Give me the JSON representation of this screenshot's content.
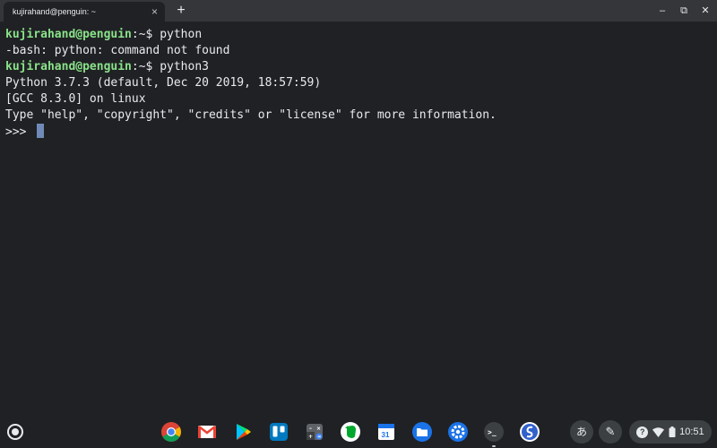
{
  "window": {
    "tab_title": "kujirahand@penguin: ~",
    "tab_close": "×",
    "new_tab": "+",
    "minimize": "–",
    "restore": "⧉",
    "close": "✕"
  },
  "terminal": {
    "lines": [
      {
        "user_host": "kujirahand@penguin",
        "path": ":~",
        "cmd": "$ python"
      },
      {
        "text": "-bash: python: command not found"
      },
      {
        "user_host": "kujirahand@penguin",
        "path": ":~",
        "cmd": "$ python3"
      },
      {
        "text": "Python 3.7.3 (default, Dec 20 2019, 18:57:59)"
      },
      {
        "text": "[GCC 8.3.0] on linux"
      },
      {
        "text": "Type \"help\", \"copyright\", \"credits\" or \"license\" for more information."
      },
      {
        "text": ">>> "
      }
    ]
  },
  "shelf": {
    "apps": [
      {
        "name": "chrome-icon",
        "color": "#4285f4"
      },
      {
        "name": "gmail-icon",
        "color": "#ffffff"
      },
      {
        "name": "play-store-icon",
        "color": "#ffffff"
      },
      {
        "name": "trello-icon",
        "color": "#0079bf"
      },
      {
        "name": "calculator-icon",
        "color": "#5f6368"
      },
      {
        "name": "evernote-icon",
        "color": "#ffffff"
      },
      {
        "name": "calendar-icon",
        "color": "#ffffff"
      },
      {
        "name": "files-icon",
        "color": "#1a73e8"
      },
      {
        "name": "settings-icon",
        "color": "#1a73e8"
      },
      {
        "name": "terminal-icon",
        "color": "#3c4043"
      },
      {
        "name": "simplenote-icon",
        "color": "#ffffff"
      }
    ],
    "terminal_glyph": ">_",
    "calendar_day": "31",
    "ime_label": "あ",
    "tray_time": "10:51",
    "tray_help": "?"
  }
}
